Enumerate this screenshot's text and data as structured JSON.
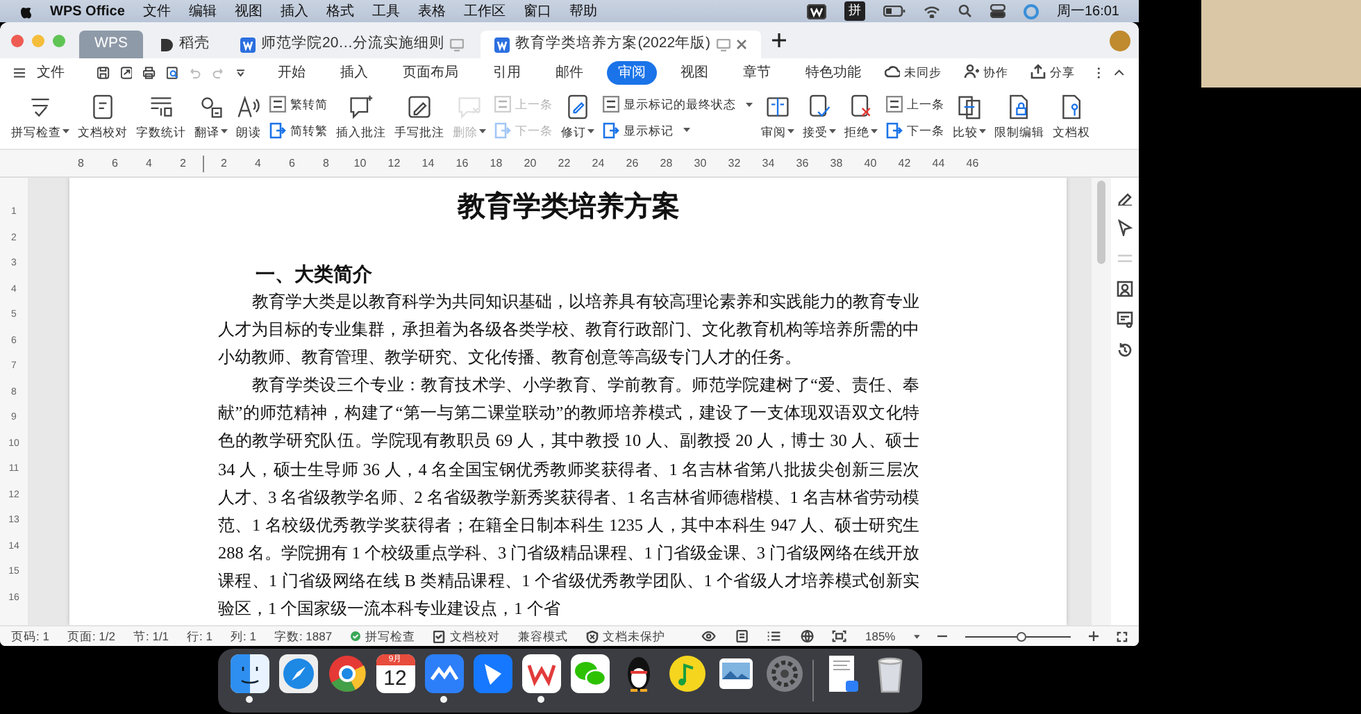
{
  "menu_bar": {
    "app_name": "WPS Office",
    "menus": [
      "文件",
      "编辑",
      "视图",
      "插入",
      "格式",
      "工具",
      "表格",
      "工作区",
      "窗口",
      "帮助"
    ],
    "input_method": "拼",
    "clock": "周一16:01"
  },
  "tabs": [
    {
      "label": "WPS",
      "kind": "home",
      "selected": false
    },
    {
      "label": "稻壳",
      "kind": "store",
      "selected": false
    },
    {
      "label": "师范学院20…分流实施细则",
      "kind": "doc",
      "selected": false
    },
    {
      "label": "教育学类培养方案(2022年版)",
      "kind": "doc",
      "selected": true
    }
  ],
  "toolbar": {
    "file_menu": "文件",
    "ribbon_tabs": [
      {
        "label": "开始",
        "selected": false
      },
      {
        "label": "插入",
        "selected": false
      },
      {
        "label": "页面布局",
        "selected": false
      },
      {
        "label": "引用",
        "selected": false
      },
      {
        "label": "邮件",
        "selected": false
      },
      {
        "label": "审阅",
        "selected": true
      },
      {
        "label": "视图",
        "selected": false
      },
      {
        "label": "章节",
        "selected": false
      },
      {
        "label": "特色功能",
        "selected": false
      }
    ],
    "actions": [
      "未同步",
      "协作",
      "分享"
    ]
  },
  "ribbon": [
    {
      "kind": "large",
      "label": "拼写检查",
      "dropdown": true,
      "disabled": false
    },
    {
      "kind": "large",
      "label": "文档校对",
      "dropdown": false,
      "disabled": false
    },
    {
      "kind": "large",
      "label": "字数统计",
      "dropdown": false,
      "disabled": false
    },
    {
      "kind": "large",
      "label": "翻译",
      "dropdown": true,
      "disabled": false
    },
    {
      "kind": "large",
      "label": "朗读",
      "dropdown": false,
      "disabled": false
    },
    {
      "kind": "pair",
      "items": [
        {
          "label": "繁转简",
          "dropdown": false,
          "disabled": false
        },
        {
          "label": "简转繁",
          "dropdown": false,
          "disabled": false
        }
      ]
    },
    {
      "kind": "large",
      "label": "插入批注",
      "dropdown": false,
      "disabled": false
    },
    {
      "kind": "large",
      "label": "手写批注",
      "dropdown": false,
      "disabled": false
    },
    {
      "kind": "large",
      "label": "删除",
      "dropdown": true,
      "disabled": true
    },
    {
      "kind": "pair",
      "items": [
        {
          "label": "上一条",
          "dropdown": false,
          "disabled": true
        },
        {
          "label": "下一条",
          "dropdown": false,
          "disabled": true
        }
      ]
    },
    {
      "kind": "large",
      "label": "修订",
      "dropdown": true,
      "disabled": false
    },
    {
      "kind": "pair",
      "items": [
        {
          "label": "显示标记的最终状态",
          "dropdown": true,
          "disabled": false
        },
        {
          "label": "显示标记",
          "dropdown": true,
          "disabled": false
        }
      ]
    },
    {
      "kind": "large",
      "label": "审阅",
      "dropdown": true,
      "disabled": false
    },
    {
      "kind": "large",
      "label": "接受",
      "dropdown": true,
      "disabled": false
    },
    {
      "kind": "large",
      "label": "拒绝",
      "dropdown": true,
      "disabled": false
    },
    {
      "kind": "pair",
      "items": [
        {
          "label": "上一条",
          "dropdown": false,
          "disabled": false
        },
        {
          "label": "下一条",
          "dropdown": false,
          "disabled": false
        }
      ]
    },
    {
      "kind": "large",
      "label": "比较",
      "dropdown": true,
      "disabled": false
    },
    {
      "kind": "large",
      "label": "限制编辑",
      "dropdown": false,
      "disabled": false
    },
    {
      "kind": "large",
      "label": "文档权",
      "dropdown": false,
      "disabled": false
    }
  ],
  "ruler": {
    "left_labels": [
      "8",
      "6",
      "4",
      "2"
    ],
    "right_labels": [
      "2",
      "4",
      "6",
      "8",
      "10",
      "12",
      "14",
      "16",
      "18",
      "20",
      "22",
      "24",
      "26",
      "28",
      "30",
      "32",
      "34",
      "36",
      "38",
      "40",
      "42",
      "44",
      "46"
    ]
  },
  "vertical_ruler": [
    "1",
    "2",
    "3",
    "4",
    "5",
    "6",
    "7",
    "8",
    "9",
    "10",
    "11",
    "12",
    "13",
    "14",
    "15",
    "16"
  ],
  "document": {
    "title": "教育学类培养方案",
    "heading": "一、大类简介",
    "paragraphs": [
      "教育学大类是以教育科学为共同知识基础，以培养具有较高理论素养和实践能力的教育专业人才为目标的专业集群，承担着为各级各类学校、教育行政部门、文化教育机构等培养所需的中小幼教师、教育管理、教学研究、文化传播、教育创意等高级专门人才的任务。",
      "教育学类设三个专业：教育技术学、小学教育、学前教育。师范学院建树了“爱、责任、奉献”的师范精神，构建了“第一与第二课堂联动”的教师培养模式，建设了一支体现双语双文化特色的教学研究队伍。学院现有教职员 69 人，其中教授 10 人、副教授 20 人，博士 30 人、硕士 34 人，硕士生导师 36 人，4 名全国宝钢优秀教师奖获得者、1 名吉林省第八批拔尖创新三层次人才、3 名省级教学名师、2 名省级教学新秀奖获得者、1 名吉林省师德楷模、1 名吉林省劳动模范、1 名校级优秀教学奖获得者；在籍全日制本科生 1235 人，其中本科生 947 人、硕士研究生 288 名。学院拥有 1 个校级重点学科、3 门省级精品课程、1 门省级金课、3 门省级网络在线开放课程、1 门省级网络在线 B 类精品课程、1 个省级优秀教学团队、1 个省级人才培养模式创新实验区，1 个国家级一流本科专业建设点，1 个省"
    ]
  },
  "status_bar": {
    "items": [
      {
        "label": "页码: 1",
        "kind": "text"
      },
      {
        "label": "页面: 1/2",
        "kind": "text"
      },
      {
        "label": "节: 1/1",
        "kind": "text"
      },
      {
        "label": "行: 1",
        "kind": "text"
      },
      {
        "label": "列: 1",
        "kind": "text"
      },
      {
        "label": "字数: 1887",
        "kind": "text"
      },
      {
        "label": "拼写检查",
        "kind": "spell"
      },
      {
        "label": "文档校对",
        "kind": "proof"
      },
      {
        "label": "兼容模式",
        "kind": "text"
      },
      {
        "label": "文档未保护",
        "kind": "shield"
      }
    ],
    "zoom": "185%",
    "zoom_slider": {
      "level": 0.53
    }
  },
  "dock": [
    {
      "kind": "finder",
      "running": true
    },
    {
      "kind": "safari",
      "running": false
    },
    {
      "kind": "chrome",
      "running": false
    },
    {
      "kind": "calendar",
      "running": false,
      "month": "9月",
      "day": "12"
    },
    {
      "kind": "lark",
      "running": true
    },
    {
      "kind": "feishu",
      "running": false
    },
    {
      "kind": "wps",
      "running": true
    },
    {
      "kind": "wechat",
      "running": false
    },
    {
      "kind": "qq",
      "running": false
    },
    {
      "kind": "music",
      "running": false
    },
    {
      "kind": "preview",
      "running": false
    },
    {
      "kind": "settings",
      "running": false
    },
    {
      "kind": "separator"
    },
    {
      "kind": "document",
      "running": false
    },
    {
      "kind": "trash",
      "running": false
    }
  ]
}
